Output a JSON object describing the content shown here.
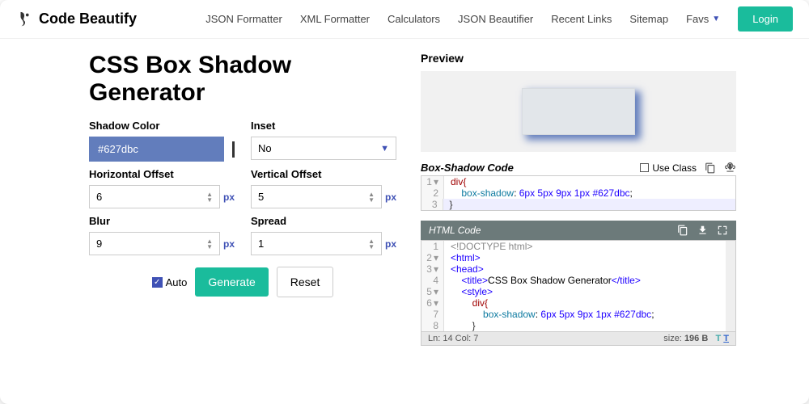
{
  "header": {
    "brand": "Code Beautify",
    "nav": [
      "JSON Formatter",
      "XML Formatter",
      "Calculators",
      "JSON Beautifier",
      "Recent Links",
      "Sitemap"
    ],
    "favs": "Favs",
    "login": "Login"
  },
  "page": {
    "title": "CSS Box Shadow Generator"
  },
  "form": {
    "shadow_color": {
      "label": "Shadow Color",
      "value": "#627dbc"
    },
    "inset": {
      "label": "Inset",
      "value": "No"
    },
    "h_offset": {
      "label": "Horizontal Offset",
      "value": "6",
      "unit": "px"
    },
    "v_offset": {
      "label": "Vertical Offset",
      "value": "5",
      "unit": "px"
    },
    "blur": {
      "label": "Blur",
      "value": "9",
      "unit": "px"
    },
    "spread": {
      "label": "Spread",
      "value": "1",
      "unit": "px"
    },
    "auto": "Auto",
    "generate": "Generate",
    "reset": "Reset"
  },
  "preview": {
    "label": "Preview"
  },
  "box_code": {
    "title": "Box-Shadow Code",
    "use_class": "Use Class",
    "lines": {
      "l1": "div{",
      "l2_prop": "box-shadow",
      "l2_val": "6px 5px 9px 1px #627dbc",
      "l3": "}"
    }
  },
  "html_code": {
    "title": "HTML Code",
    "lines": {
      "l1": "<!DOCTYPE html>",
      "l2": "<html>",
      "l3": "<head>",
      "l4a": "<title>",
      "l4b": "CSS Box Shadow Generator",
      "l4c": "</title>",
      "l5": "<style>",
      "l6": "div{",
      "l7_prop": "box-shadow",
      "l7_val": "6px 5px 9px 1px #627dbc",
      "l8": "}"
    },
    "status_left": "Ln: 14 Col: 7",
    "status_right_label": "size:",
    "status_right_val": "196 B"
  }
}
